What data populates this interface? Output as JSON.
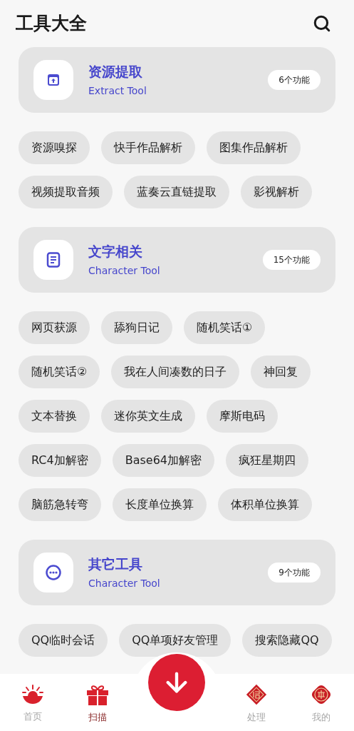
{
  "header": {
    "title": "工具大全"
  },
  "sections": [
    {
      "title": "资源提取",
      "subtitle": "Extract Tool",
      "count": "6个功能",
      "kind": "extract",
      "tools": [
        "资源嗅探",
        "快手作品解析",
        "图集作品解析",
        "视频提取音频",
        "蓝奏云直链提取",
        "影视解析"
      ]
    },
    {
      "title": "文字相关",
      "subtitle": "Character Tool",
      "count": "15个功能",
      "kind": "text",
      "tools": [
        "网页获源",
        "舔狗日记",
        "随机笑话①",
        "随机笑话②",
        "我在人间凑数的日子",
        "神回复",
        "文本替换",
        "迷你英文生成",
        "摩斯电码",
        "RC4加解密",
        "Base64加解密",
        "疯狂星期四",
        "脑筋急转弯",
        "长度单位换算",
        "体积单位换算"
      ]
    },
    {
      "title": "其它工具",
      "subtitle": "Character Tool",
      "count": "9个功能",
      "kind": "other",
      "tools": [
        "QQ临时会话",
        "QQ单项好友管理",
        "搜索隐藏QQ"
      ]
    }
  ],
  "nav": [
    {
      "label": "首页",
      "kind": "ingot",
      "selected": false
    },
    {
      "label": "扫描",
      "kind": "gift",
      "selected": true
    },
    {
      "kind": "download"
    },
    {
      "label": "处理",
      "kind": "fu",
      "selected": false
    },
    {
      "label": "我的",
      "kind": "medallion",
      "selected": false
    }
  ]
}
